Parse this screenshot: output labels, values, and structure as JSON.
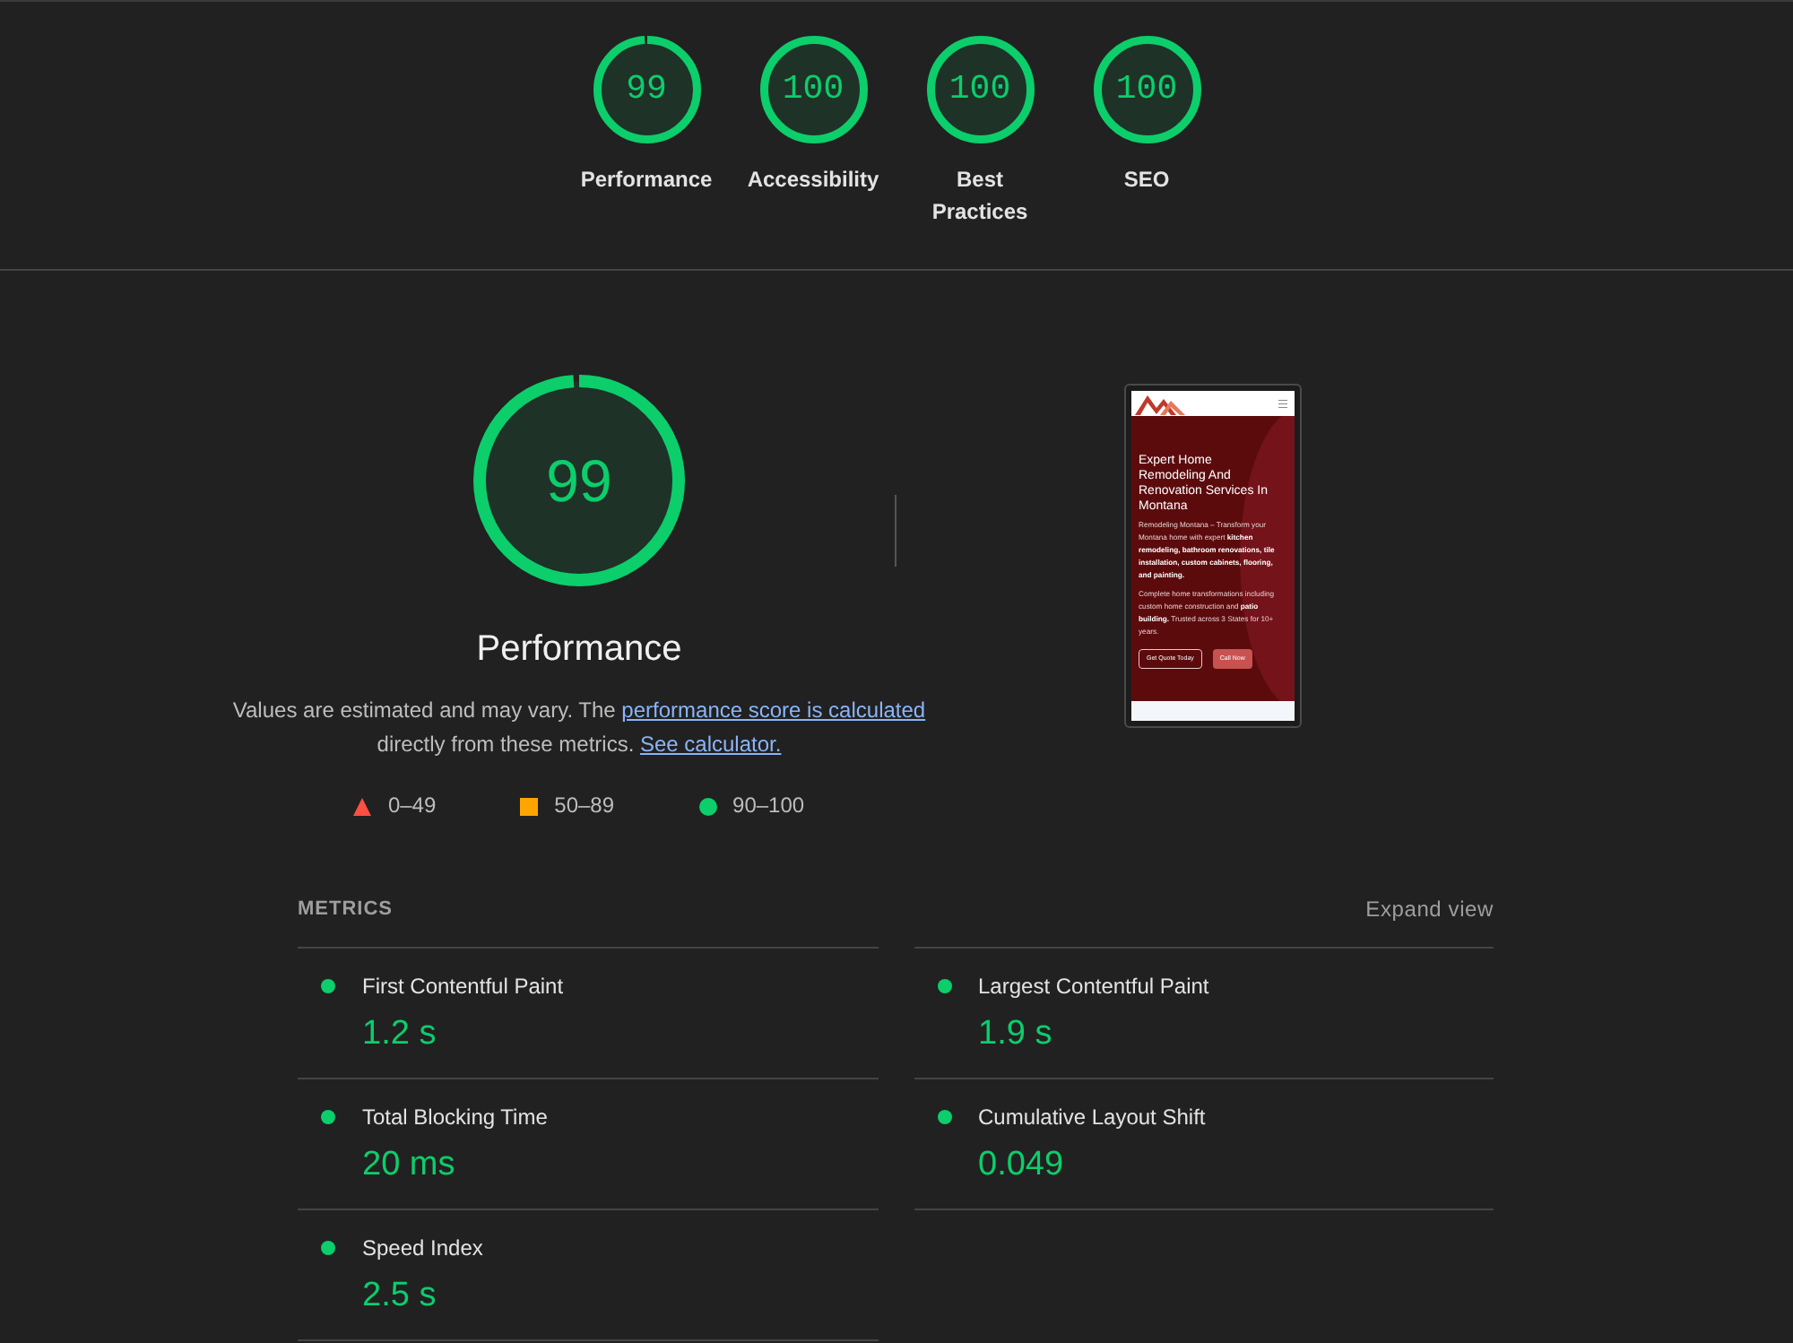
{
  "categories": [
    {
      "label": "Performance",
      "score": "99",
      "level": 0.99
    },
    {
      "label": "Accessibility",
      "score": "100",
      "level": 1
    },
    {
      "label": "Best Practices",
      "score": "100",
      "level": 1
    },
    {
      "label": "SEO",
      "score": "100",
      "level": 1
    }
  ],
  "performance": {
    "score": "99",
    "level": 0.99,
    "title": "Performance",
    "description": [
      {
        "kind": "text",
        "text": "Values are estimated and may vary. The "
      },
      {
        "kind": "link",
        "text": "performance score is calculated"
      },
      {
        "kind": "text",
        "text": " directly from these metrics. "
      },
      {
        "kind": "link",
        "text": "See calculator."
      }
    ],
    "legend": [
      {
        "kind": "fail",
        "label": "0–49",
        "color": "#ff4e42"
      },
      {
        "kind": "average",
        "label": "50–89",
        "color": "#ffa400"
      },
      {
        "kind": "pass",
        "label": "90–100",
        "color": "#0cce6b"
      }
    ]
  },
  "screenshot": {
    "heading": "Expert Home Remodeling And Renovation Services In Montana",
    "paragraphs": [
      "Remodeling Montana – Transform your Montana home with expert **kitchen remodeling, bathroom renovations, tile installation, custom cabinets, flooring, and painting.**",
      "Complete home transformations including custom home construction and **patio building.** Trusted across 3 States for 10+ years."
    ],
    "buttons": [
      {
        "kind": "outline",
        "label": "Get Quote Today"
      },
      {
        "kind": "filled",
        "label": "Call Now"
      }
    ]
  },
  "metrics": {
    "title": "METRICS",
    "toggle": "Expand view",
    "items": [
      {
        "label": "First Contentful Paint",
        "value": "1.2 s"
      },
      {
        "label": "Largest Contentful Paint",
        "value": "1.9 s"
      },
      {
        "label": "Total Blocking Time",
        "value": "20 ms"
      },
      {
        "label": "Cumulative Layout Shift",
        "value": "0.049"
      },
      {
        "label": "Speed Index",
        "value": "2.5 s"
      }
    ]
  }
}
